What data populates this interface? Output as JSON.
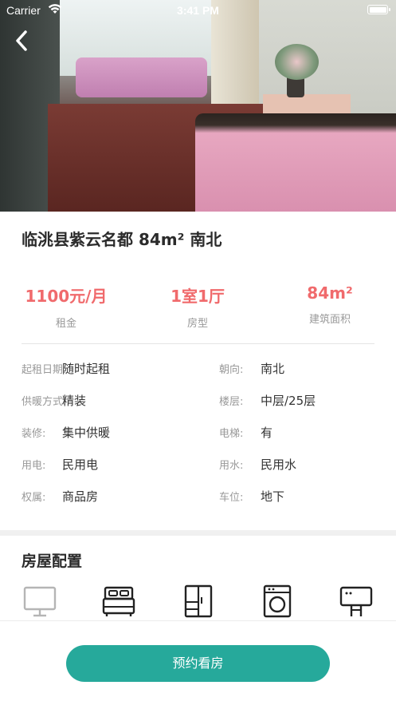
{
  "status_bar": {
    "carrier": "Carrier",
    "time": "3:41 PM"
  },
  "listing": {
    "title": "临洮县紫云名都 84m² 南北",
    "stats": [
      {
        "value": "1100元/月",
        "label": "租金"
      },
      {
        "value": "1室1厅",
        "label": "房型"
      },
      {
        "value": "84m²",
        "label": "建筑面积"
      }
    ],
    "details": [
      {
        "left": {
          "key": "起租日期:",
          "value": "随时起租"
        },
        "right": {
          "key": "朝向:",
          "value": "南北"
        }
      },
      {
        "left": {
          "key": "供暖方式:",
          "value": "精装"
        },
        "right": {
          "key": "楼层:",
          "value": "中层/25层"
        }
      },
      {
        "left": {
          "key": "装修:",
          "value": "集中供暖"
        },
        "right": {
          "key": "电梯:",
          "value": "有"
        }
      },
      {
        "left": {
          "key": "用电:",
          "value": "民用电"
        },
        "right": {
          "key": "用水:",
          "value": "民用水"
        }
      },
      {
        "left": {
          "key": "权属:",
          "value": "商品房"
        },
        "right": {
          "key": "车位:",
          "value": "地下"
        }
      }
    ]
  },
  "facilities": {
    "title": "房屋配置",
    "icons": [
      {
        "icon": "tv-icon",
        "available": false
      },
      {
        "icon": "bed-icon",
        "available": true
      },
      {
        "icon": "wardrobe-icon",
        "available": true
      },
      {
        "icon": "washing-machine-icon",
        "available": true
      },
      {
        "icon": "water-heater-icon",
        "available": true
      }
    ]
  },
  "actions": {
    "book_label": "预约看房"
  },
  "colors": {
    "accent": "#26a99b",
    "price": "#f06a6c",
    "muted": "#999999"
  }
}
